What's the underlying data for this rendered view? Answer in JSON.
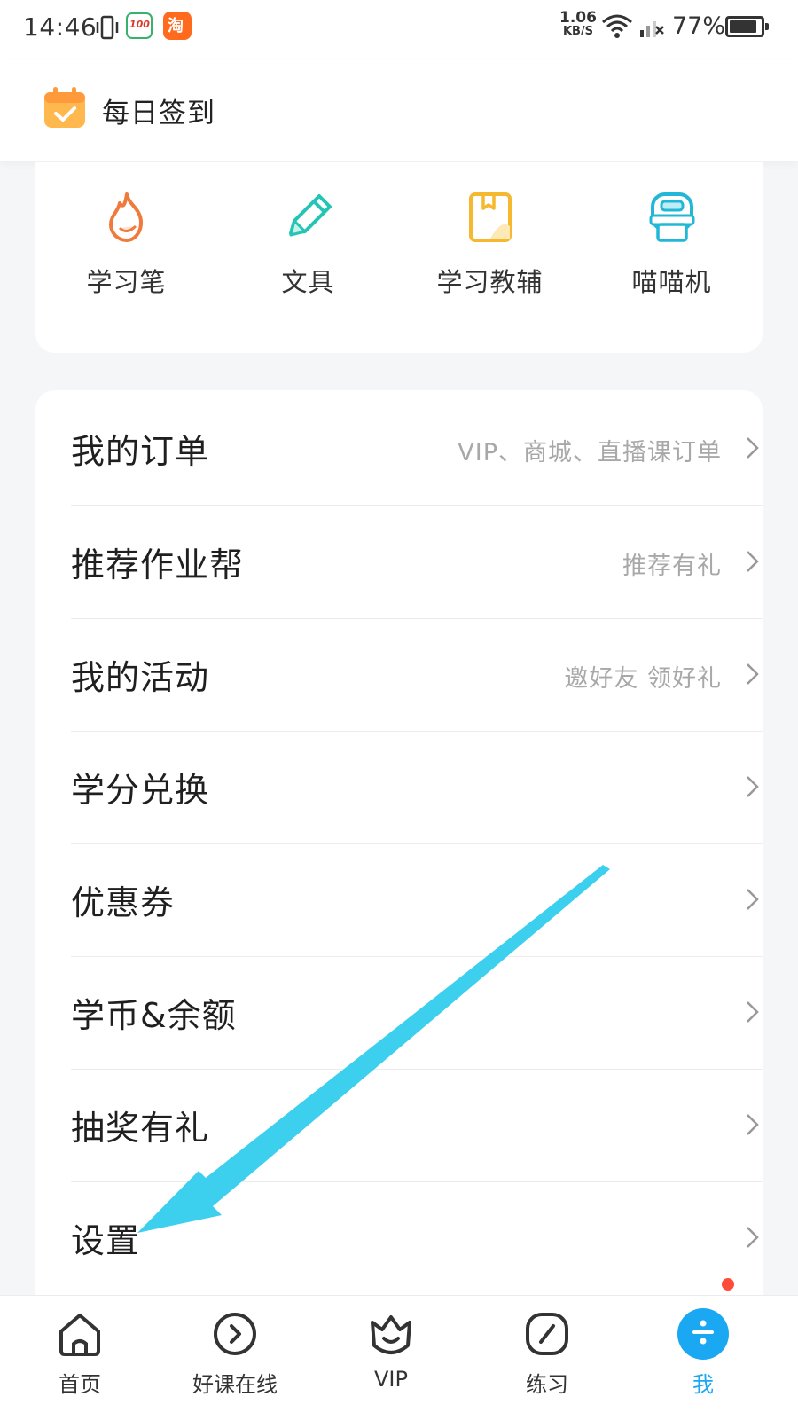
{
  "status_bar": {
    "time": "14:46",
    "net_speed_value": "1.06",
    "net_speed_unit": "KB/S",
    "battery_percent": "77%",
    "app_icon_1": "100",
    "app_icon_2": "淘"
  },
  "checkin": {
    "label": "每日签到",
    "icon": "calendar-check-icon"
  },
  "categories": [
    {
      "label": "学习笔",
      "icon": "flame-icon",
      "color": "#f07a3c"
    },
    {
      "label": "文具",
      "icon": "pencil-icon",
      "color": "#25c5b5"
    },
    {
      "label": "学习教辅",
      "icon": "book-icon",
      "color": "#f5b82e"
    },
    {
      "label": "喵喵机",
      "icon": "printer-icon",
      "color": "#22b7d6"
    }
  ],
  "menu": [
    {
      "title": "我的订单",
      "hint": "VIP、商城、直播课订单"
    },
    {
      "title": "推荐作业帮",
      "hint": "推荐有礼"
    },
    {
      "title": "我的活动",
      "hint": "邀好友 领好礼"
    },
    {
      "title": "学分兑换",
      "hint": ""
    },
    {
      "title": "优惠券",
      "hint": ""
    },
    {
      "title": "学币&余额",
      "hint": ""
    },
    {
      "title": "抽奖有礼",
      "hint": ""
    },
    {
      "title": "设置",
      "hint": ""
    }
  ],
  "tabs": [
    {
      "label": "首页",
      "icon": "home-icon"
    },
    {
      "label": "好课在线",
      "icon": "play-circle-icon"
    },
    {
      "label": "VIP",
      "icon": "crown-icon"
    },
    {
      "label": "练习",
      "icon": "pen-square-icon"
    },
    {
      "label": "我",
      "icon": "profile-icon",
      "active": true
    }
  ],
  "colors": {
    "accent": "#1aa8f2",
    "annotation_arrow": "#3ccfee",
    "badge": "#ff4b3a"
  }
}
